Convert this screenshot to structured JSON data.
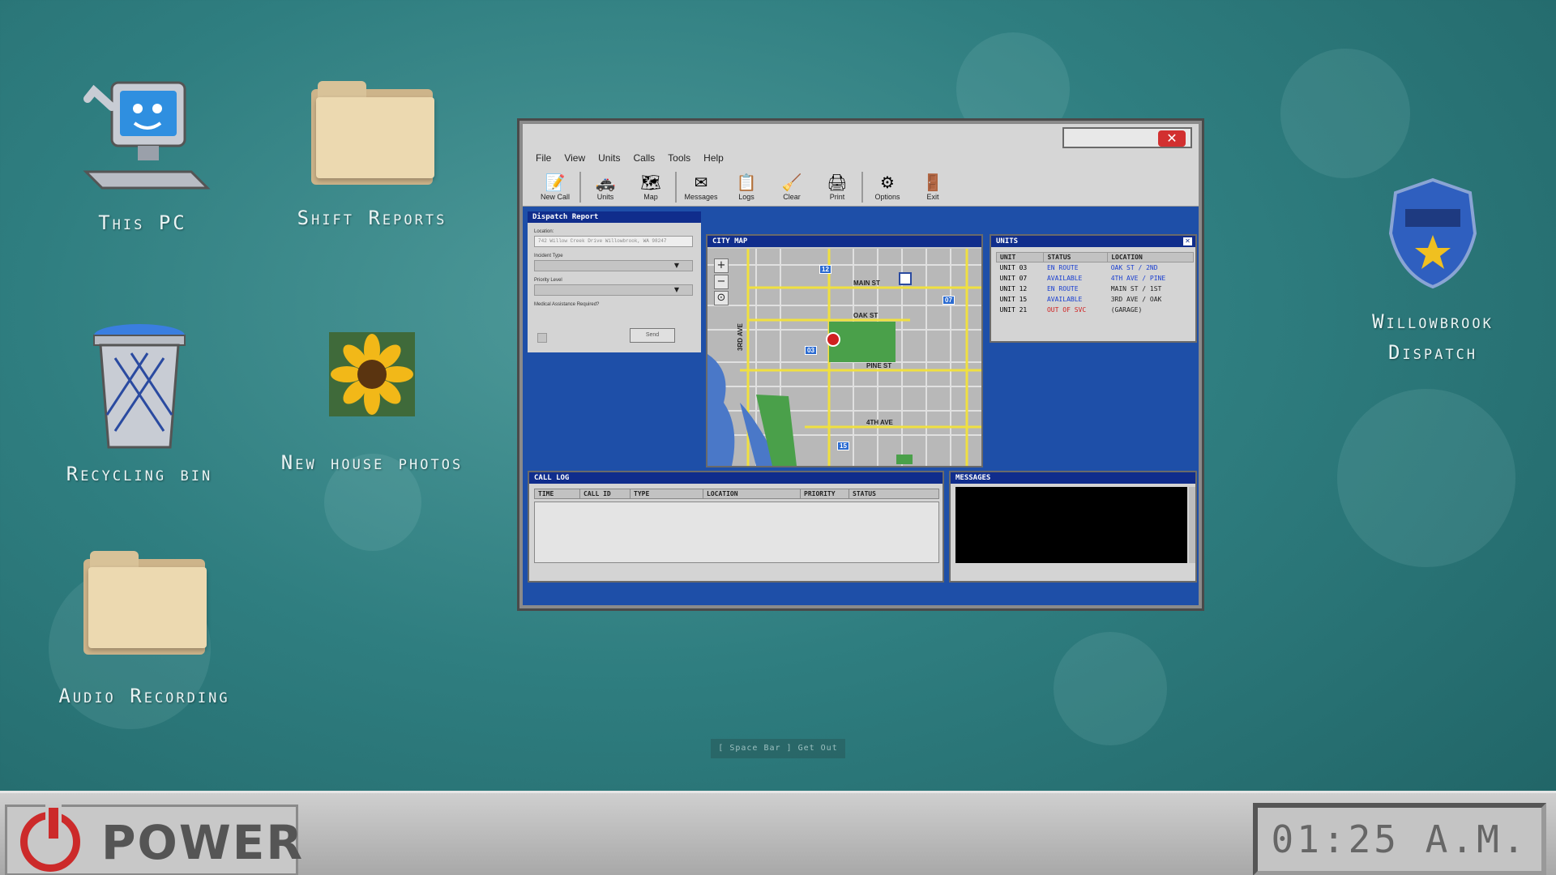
{
  "desktop": {
    "icons": [
      {
        "label": "This PC"
      },
      {
        "label": "Shift Reports"
      },
      {
        "label": "Recycling bin"
      },
      {
        "label": "New house photos"
      },
      {
        "label": "Audio Recording"
      },
      {
        "label": "Willowbrook Dispatch"
      }
    ],
    "hint": "[ Space Bar ] Get Out"
  },
  "window": {
    "menu": [
      "File",
      "View",
      "Units",
      "Calls",
      "Tools",
      "Help"
    ],
    "toolbar": [
      {
        "label": "New Call",
        "icon": "new-call-icon"
      },
      {
        "label": "Units",
        "icon": "police-car-icon"
      },
      {
        "label": "Map",
        "icon": "map-icon"
      },
      {
        "label": "Messages",
        "icon": "envelope-icon"
      },
      {
        "label": "Logs",
        "icon": "notepad-icon"
      },
      {
        "label": "Clear",
        "icon": "broom-icon"
      },
      {
        "label": "Print",
        "icon": "printer-icon"
      },
      {
        "label": "Options",
        "icon": "gear-icon"
      },
      {
        "label": "Exit",
        "icon": "exit-door-icon"
      }
    ],
    "report": {
      "title": "Dispatch Report",
      "location_label": "Location:",
      "location_value": "742 Willow Creek Drive Willowbrook, WA 98247",
      "incident_label": "Incident Type",
      "priority_label": "Priority Level",
      "medical_label": "Medical Assistance Required?",
      "send_label": "Send"
    },
    "map": {
      "title": "CITY MAP",
      "streets": [
        "MAIN ST",
        "OAK ST",
        "PINE ST",
        "4TH AVE",
        "3RD AVE"
      ],
      "unit_tags": [
        "12",
        "07",
        "03",
        "15"
      ]
    },
    "units": {
      "title": "UNITS",
      "columns": [
        "UNIT",
        "STATUS",
        "LOCATION"
      ],
      "rows": [
        {
          "unit": "UNIT 03",
          "status": "EN ROUTE",
          "location": "OAK ST / 2ND",
          "status_color": "#1a3fd0",
          "loc_color": "#1a3fd0"
        },
        {
          "unit": "UNIT 07",
          "status": "AVAILABLE",
          "location": "4TH AVE / PINE",
          "status_color": "#1a3fd0",
          "loc_color": "#1a3fd0"
        },
        {
          "unit": "UNIT 12",
          "status": "EN ROUTE",
          "location": "MAIN ST / 1ST",
          "status_color": "#1a3fd0",
          "loc_color": "#222222"
        },
        {
          "unit": "UNIT 15",
          "status": "AVAILABLE",
          "location": "3RD AVE / OAK",
          "status_color": "#1a3fd0",
          "loc_color": "#222222"
        },
        {
          "unit": "UNIT 21",
          "status": "OUT OF SVC",
          "location": "(GARAGE)",
          "status_color": "#d02020",
          "loc_color": "#222222"
        }
      ]
    },
    "calllog": {
      "title": "CALL LOG",
      "columns": [
        "TIME",
        "CALL ID",
        "TYPE",
        "LOCATION",
        "PRIORITY",
        "STATUS"
      ]
    },
    "messages": {
      "title": "MESSAGES"
    }
  },
  "taskbar": {
    "power_label": "POWER",
    "clock": "01:25 A.M."
  }
}
